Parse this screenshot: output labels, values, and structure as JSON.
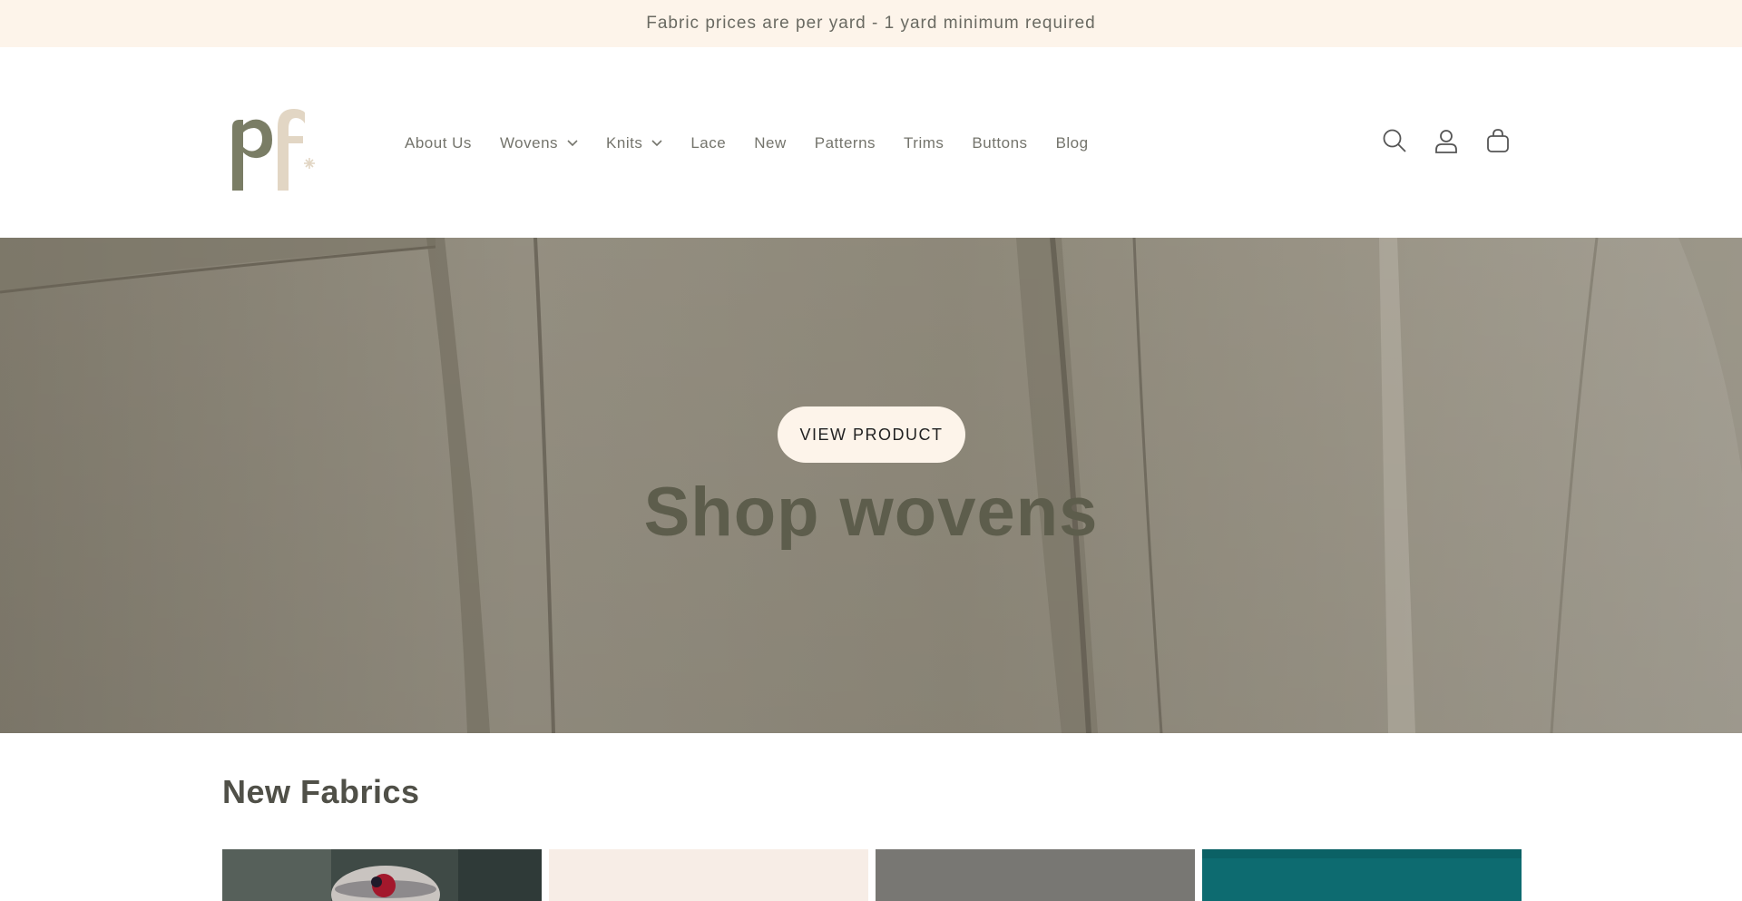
{
  "announcement": {
    "text": "Fabric prices are per yard - 1 yard minimum required"
  },
  "header": {
    "logo_alt": "pf",
    "nav": [
      {
        "label": "About Us",
        "has_dropdown": false
      },
      {
        "label": "Wovens",
        "has_dropdown": true
      },
      {
        "label": "Knits",
        "has_dropdown": true
      },
      {
        "label": "Lace",
        "has_dropdown": false
      },
      {
        "label": "New",
        "has_dropdown": false
      },
      {
        "label": "Patterns",
        "has_dropdown": false
      },
      {
        "label": "Trims",
        "has_dropdown": false
      },
      {
        "label": "Buttons",
        "has_dropdown": false
      },
      {
        "label": "Blog",
        "has_dropdown": false
      }
    ],
    "icons": [
      "search-icon",
      "account-icon",
      "cart-icon"
    ]
  },
  "hero": {
    "button_label": "VIEW PRODUCT",
    "title": "Shop wovens"
  },
  "new_fabrics": {
    "title": "New Fabrics",
    "products": [
      {
        "image": "knit-headband-photo",
        "color": "#3f4a46"
      },
      {
        "image": "cream-fabric-photo",
        "color": "#f7ede6"
      },
      {
        "image": "grey-fabric-photo",
        "color": "#7d7c78"
      },
      {
        "image": "teal-fabric-photo",
        "color": "#0d6b70"
      }
    ]
  },
  "colors": {
    "announcement_bg": "#fdf4ea",
    "button_bg": "#fdf4ea",
    "logo_green": "#7a7d65",
    "logo_cream": "#e2d6c4"
  }
}
